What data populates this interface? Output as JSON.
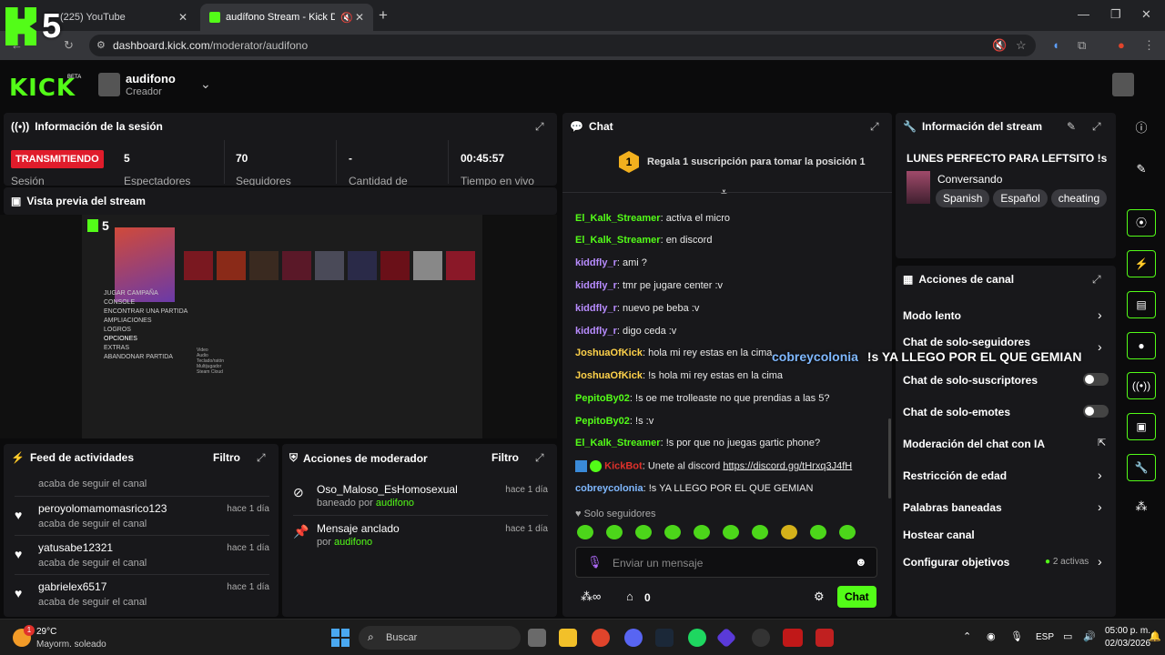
{
  "browser": {
    "tabs": [
      {
        "label": "(225) YouTube"
      },
      {
        "label": "audífono Stream - Kick Das"
      }
    ],
    "url_domain": "dashboard.kick.com",
    "url_path": "/moderator/audifono"
  },
  "overlay": {
    "number": "5"
  },
  "header": {
    "logo": "KICK",
    "beta": "BETA",
    "username": "audifono",
    "role": "Creador"
  },
  "session": {
    "title": "Información de la sesión",
    "status": "TRANSMITIENDO",
    "stats": [
      {
        "value": "5",
        "label": "Espectadores"
      },
      {
        "value": "70",
        "label": "Seguidores"
      },
      {
        "value": "-",
        "label": "Cantidad de"
      },
      {
        "value": "00:45:57",
        "label": "Tiempo en vivo"
      }
    ],
    "status_label": "Sesión"
  },
  "preview": {
    "title": "Vista previa del stream",
    "menu": [
      "JUGAR CAMPAÑA",
      "CONSOLE",
      "ENCONTRAR UNA PARTIDA",
      "AMPLIACIONES",
      "LOGROS",
      "OPCIONES",
      "EXTRAS",
      "ABANDONAR PARTIDA"
    ],
    "submenu": [
      "Video",
      "Audio",
      "Teclado/ratón",
      "Multijugador",
      "Steam Cloud"
    ],
    "overlay_number": "5"
  },
  "feed": {
    "title": "Feed de actividades",
    "filter": "Filtro",
    "items": [
      {
        "name": "",
        "sub": "acaba de seguir el canal",
        "time": ""
      },
      {
        "name": "peroyolomamomasrico123",
        "sub": "acaba de seguir el canal",
        "time": "hace 1 día"
      },
      {
        "name": "yatusabe12321",
        "sub": "acaba de seguir el canal",
        "time": "hace 1 día"
      },
      {
        "name": "gabrielex6517",
        "sub": "acaba de seguir el canal",
        "time": "hace 1 día"
      }
    ]
  },
  "modactions": {
    "title": "Acciones de moderador",
    "filter": "Filtro",
    "items": [
      {
        "name": "Oso_Maloso_EsHomosexual",
        "sub_prefix": "baneado por",
        "by": "audifono",
        "time": "hace 1 día"
      },
      {
        "name": "Mensaje anclado",
        "sub_prefix": "por",
        "by": "audifono",
        "time": "hace 1 día"
      }
    ]
  },
  "chat": {
    "title": "Chat",
    "gift_rank": "1",
    "gift_text": "Regala 1 suscripción para tomar la posición 1",
    "messages": [
      {
        "user": "El_Kalk_Streamer",
        "color": "#53fc18",
        "text": "activa el micro"
      },
      {
        "user": "El_Kalk_Streamer",
        "color": "#53fc18",
        "text": "en discord"
      },
      {
        "user": "kiddfly_r",
        "color": "#b88cff",
        "text": "ami ?"
      },
      {
        "user": "kiddfly_r",
        "color": "#b88cff",
        "text": "tmr pe jugare center :v"
      },
      {
        "user": "kiddfly_r",
        "color": "#b88cff",
        "text": "nuevo pe beba :v"
      },
      {
        "user": "kiddfly_r",
        "color": "#b88cff",
        "text": "digo ceda :v"
      },
      {
        "user": "JoshuaOfKick",
        "color": "#ffd24a",
        "text": "hola mi rey estas en la cima"
      },
      {
        "user": "JoshuaOfKick",
        "color": "#ffd24a",
        "text": "!s hola mi rey estas en la cima"
      },
      {
        "user": "PepitoBy02",
        "color": "#53fc18",
        "text": "!s oe me trolleaste no que prendias a las 5?"
      },
      {
        "user": "PepitoBy02",
        "color": "#53fc18",
        "text": "!s :v"
      },
      {
        "user": "El_Kalk_Streamer",
        "color": "#53fc18",
        "text": "!s por que no juegas gartic phone?"
      },
      {
        "user": "KickBot",
        "color": "#e0312b",
        "text": "Unete al discord ",
        "link": "https://discord.gg/tHrxq3J4fH"
      },
      {
        "user": "cobreycolonia",
        "color": "#7fb8ff",
        "text": "!s YA LLEGO POR EL QUE GEMIAN"
      }
    ],
    "followers_only": "Solo seguidores",
    "input_placeholder": "Enviar un mensaje",
    "count": "0",
    "send": "Chat"
  },
  "chat_overlay": {
    "user": "cobreycolonia",
    "text": "!s YA LLEGO POR EL QUE GEMIAN"
  },
  "streaminfo": {
    "title": "Información del stream",
    "stream_title": "LUNES PERFECTO PARA LEFTSITO !s",
    "category": "Conversando",
    "tags": [
      "Spanish",
      "Español",
      "cheating"
    ]
  },
  "channel": {
    "title": "Acciones de canal",
    "items": [
      {
        "label": "Modo lento",
        "control": "arrow"
      },
      {
        "label": "Chat de solo-seguidores",
        "control": "arrow"
      },
      {
        "label": "Chat de solo-suscriptores",
        "control": "toggle"
      },
      {
        "label": "Chat de solo-emotes",
        "control": "toggle"
      },
      {
        "label": "Moderación del chat con IA",
        "control": "external"
      },
      {
        "label": "Restricción de edad",
        "control": "arrow"
      },
      {
        "label": "Palabras baneadas",
        "control": "arrow"
      },
      {
        "label": "Hostear canal",
        "control": "none"
      },
      {
        "label": "Configurar objetivos",
        "control": "arrow",
        "badge": "2 activas"
      }
    ]
  },
  "taskbar": {
    "temp": "29°C",
    "weather": "Mayorm. soleado",
    "search": "Buscar",
    "lang": "ESP",
    "time": "05:00 p. m.",
    "date": "02/03/2026",
    "weather_badge": "1"
  },
  "colors": {
    "accent": "#53fc18",
    "live": "#e01c2b",
    "panel": "#18181b"
  }
}
